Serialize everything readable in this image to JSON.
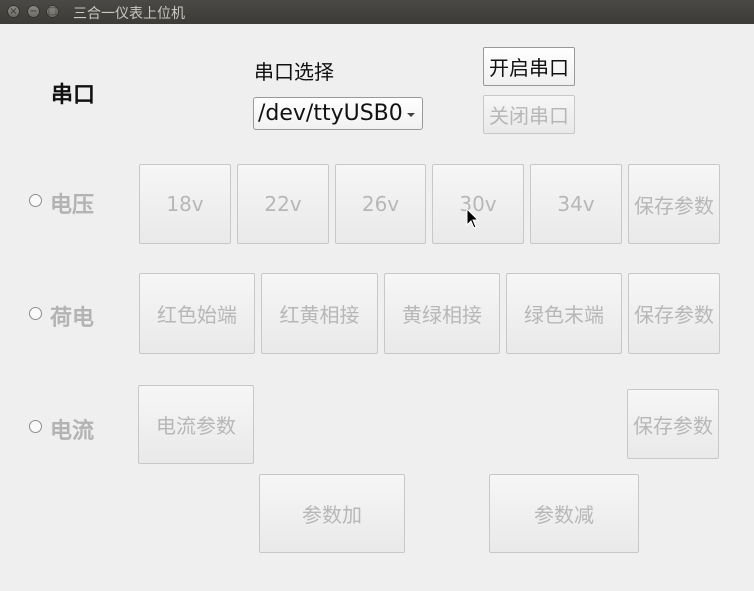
{
  "window": {
    "title": "三合一仪表上位机"
  },
  "serial": {
    "section_label": "串口",
    "select_label": "串口选择",
    "port_value": "/dev/ttyUSB0",
    "open_button": "开启串口",
    "close_button": "关闭串口"
  },
  "voltage": {
    "label": "电压",
    "buttons": [
      "18v",
      "22v",
      "26v",
      "30v",
      "34v"
    ],
    "save": "保存参数"
  },
  "charge": {
    "label": "荷电",
    "buttons": [
      "红色始端",
      "红黄相接",
      "黄绿相接",
      "绿色末端"
    ],
    "save": "保存参数"
  },
  "current": {
    "label": "电流",
    "param_button": "电流参数",
    "save": "保存参数",
    "increase": "参数加",
    "decrease": "参数减"
  }
}
